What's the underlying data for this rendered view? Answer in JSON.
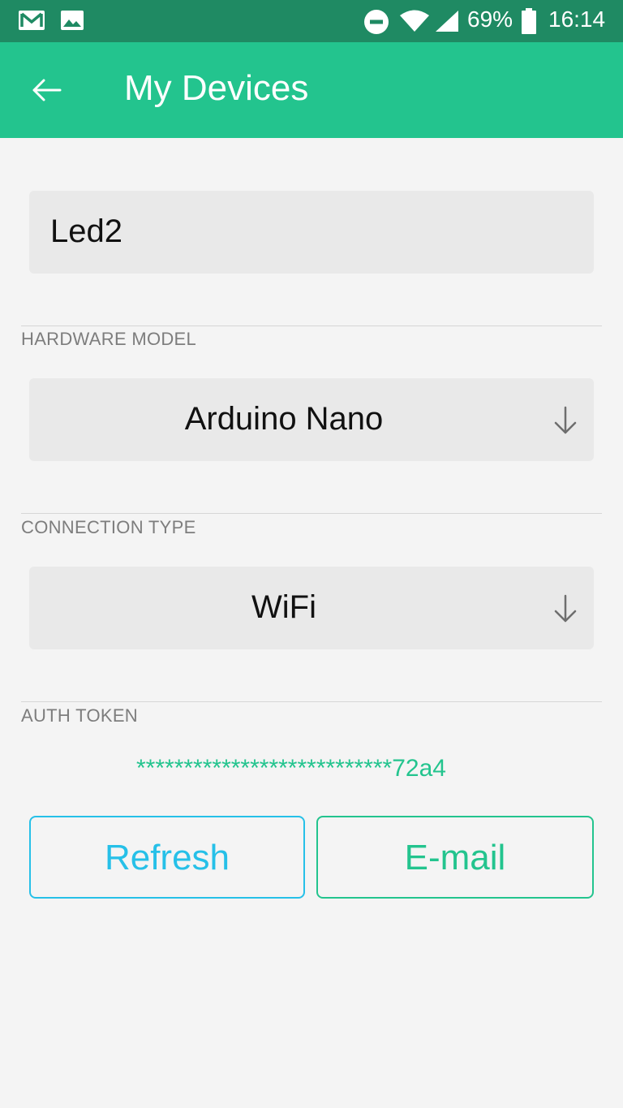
{
  "status_bar": {
    "battery_percent": "69%",
    "time": "16:14",
    "icons": [
      "gmail-icon",
      "gallery-icon",
      "do-not-disturb-icon",
      "wifi-icon",
      "signal-icon",
      "battery-icon"
    ]
  },
  "app_bar": {
    "title": "My Devices",
    "back_icon": "arrow-left-icon",
    "background_color": "#23c48e"
  },
  "device": {
    "name": "Led2"
  },
  "hardware_model": {
    "label": "HARDWARE MODEL",
    "selected": "Arduino Nano"
  },
  "connection_type": {
    "label": "CONNECTION TYPE",
    "selected": "WiFi"
  },
  "auth_token": {
    "label": "AUTH TOKEN",
    "value": "***************************72a4"
  },
  "buttons": {
    "refresh_label": "Refresh",
    "email_label": "E-mail",
    "refresh_color": "#26c0e8",
    "email_color": "#23c48e"
  }
}
